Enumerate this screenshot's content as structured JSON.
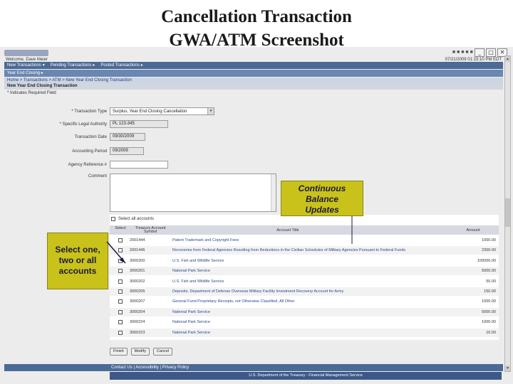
{
  "slide": {
    "title_line1": "Cancellation Transaction",
    "title_line2": "GWA/ATM Screenshot"
  },
  "window": {
    "top_dots": "■ ■ ■ ■ ■ ■",
    "btn_min": "_",
    "btn_max": "□",
    "btn_close": "✕"
  },
  "header": {
    "welcome": "Welcome, Dave Meier",
    "datetime": "07/21/2009 01:15:10 PM EDT"
  },
  "nav": {
    "items": [
      {
        "label": "New Transactions",
        "arrow": "▾"
      },
      {
        "label": "Pending Transactions",
        "arrow": "▸"
      },
      {
        "label": "Posted Transactions",
        "arrow": "▸"
      }
    ],
    "sub_item": "Year End Closing ▸",
    "breadcrumb": "Home > Transactions > ATM > New Year End Closing Transaction",
    "section_title": "New Year End Closing Transaction",
    "required_note": "* Indicates Required Field"
  },
  "form": {
    "transaction_type_label": "Transaction Type",
    "transaction_type_value": "Surplus, Year End Closing Cancellation",
    "specific_legal_authority_label": "Specific Legal Authority",
    "specific_legal_authority_value": "PL 123-345",
    "transaction_date_label": "Transaction Date",
    "transaction_date_value": "09/30/2009",
    "accounting_period_label": "Accounting Period",
    "accounting_period_value": "09/2009",
    "agency_reference_label": "Agency Reference #",
    "agency_reference_value": "",
    "comment_label": "Comment"
  },
  "accounts": {
    "select_all_label": "Select all accounts",
    "columns": {
      "select": "Select",
      "symbol": "Treasury Account Symbol",
      "title": "Account Title",
      "amount": "Amount"
    },
    "rows": [
      {
        "symbol": "2001444",
        "title": "Patent Trademark and Copyright Fees",
        "amount": "1000.00"
      },
      {
        "symbol": "2001445",
        "title": "Recoveries from Federal Agencies Resulting from Reductions in the Civilian Schedules of Military Agencies Pursuant to Federal Funds",
        "amount": "2300.00"
      },
      {
        "symbol": "3000200",
        "title": "U.S. Fish and Wildlife Service",
        "amount": "100000.00"
      },
      {
        "symbol": "3000201",
        "title": "National Park Service",
        "amount": "5000.00"
      },
      {
        "symbol": "3000202",
        "title": "U.S. Fish and Wildlife Service",
        "amount": "50.00"
      },
      {
        "symbol": "3000205",
        "title": "Deposits, Department of Defense Overseas Military Facility Investment Recovery Account for Army",
        "amount": "150.00"
      },
      {
        "symbol": "3000207",
        "title": "General Fund Proprietary Receipts, not Otherwise Classified, All Other",
        "amount": "1000.00"
      },
      {
        "symbol": "3000204",
        "title": "National Park Service",
        "amount": "5000.00"
      },
      {
        "symbol": "3000224",
        "title": "National Park Service",
        "amount": "1000.00"
      },
      {
        "symbol": "3000223",
        "title": "National Park Service",
        "amount": "10.00"
      }
    ]
  },
  "buttons": {
    "finish": "Finish",
    "modify": "Modify",
    "cancel": "Cancel"
  },
  "footer": {
    "links": "Contact Us  |  Accessibility  |  Privacy Policy",
    "dept": "U.S. Department of the Treasury - Financial Management Service"
  },
  "callouts": {
    "right": [
      "Continuous",
      "Balance",
      "Updates"
    ],
    "left": [
      "Select one,",
      "two or all",
      "accounts"
    ]
  },
  "colors": {
    "nav": "#4b6a96",
    "callout": "#c9c21a",
    "link": "#2b4a8a"
  }
}
